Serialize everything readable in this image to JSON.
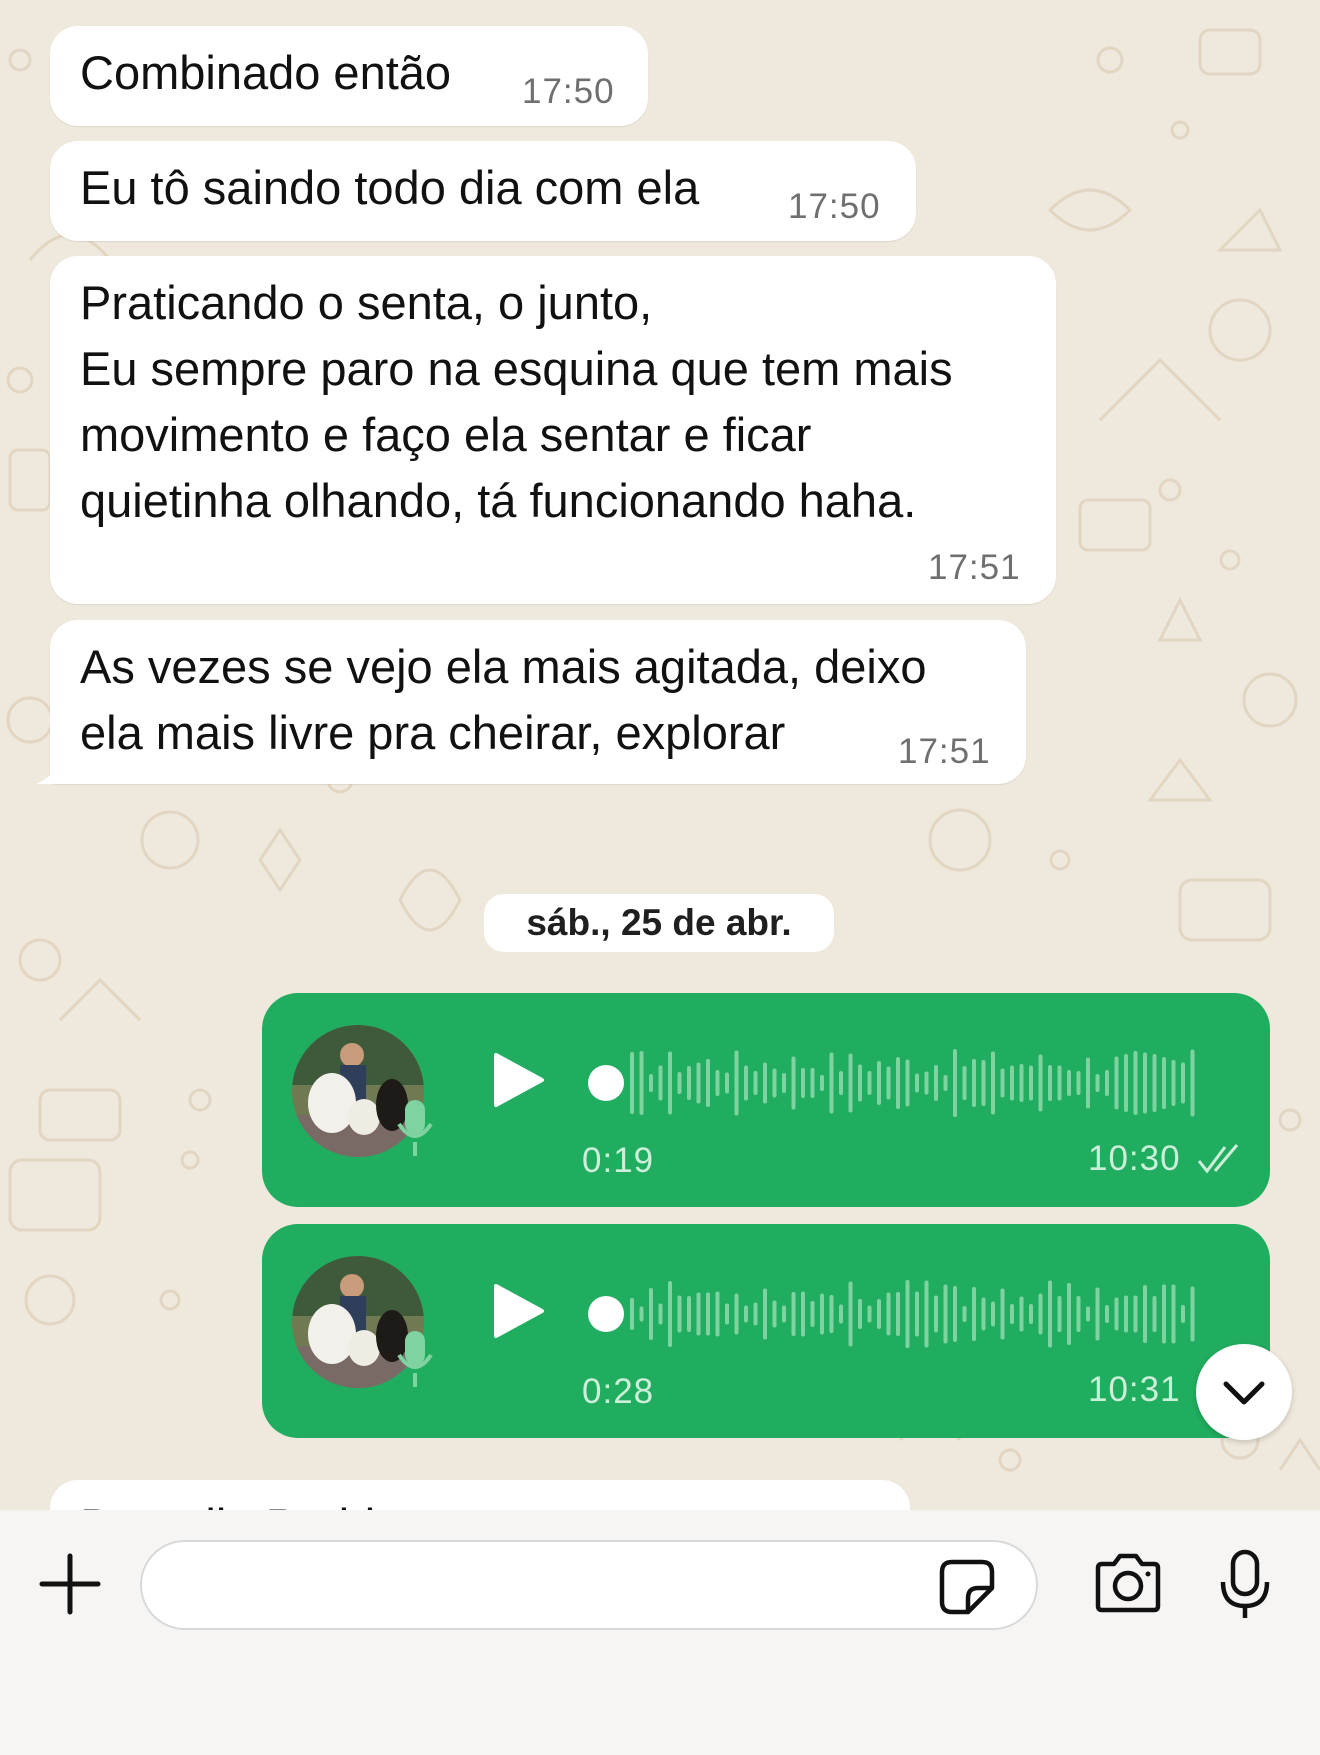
{
  "chat": {
    "incoming_messages": [
      {
        "text": "Combinado então",
        "time": "17:50"
      },
      {
        "text": "Eu tô saindo todo dia com ela",
        "time": "17:50"
      },
      {
        "text": "Praticando o senta, o junto,\nEu sempre paro na esquina que tem mais\nmovimento e faço ela sentar e ficar\nquietinha olhando, tá funcionando haha.",
        "time": "17:51"
      },
      {
        "text": "As vezes se vejo ela mais agitada, deixo\nela mais livre pra cheirar, explorar",
        "time": "17:51"
      }
    ],
    "date_separator": "sáb., 25 de abr.",
    "voice_messages": [
      {
        "duration": "0:19",
        "time": "10:30",
        "status": "read"
      },
      {
        "duration": "0:28",
        "time": "10:31",
        "status": "read"
      }
    ],
    "partial_message_text": "Bom dia Pedrin"
  },
  "colors": {
    "outgoing_bubble": "#21ad5f",
    "incoming_bubble": "#ffffff",
    "wallpaper": "#efe8dc"
  },
  "icons": {
    "attach": "plus-icon",
    "sticker": "sticker-icon",
    "camera": "camera-icon",
    "mic": "microphone-icon",
    "scroll": "chevron-down-icon",
    "play": "play-icon"
  }
}
